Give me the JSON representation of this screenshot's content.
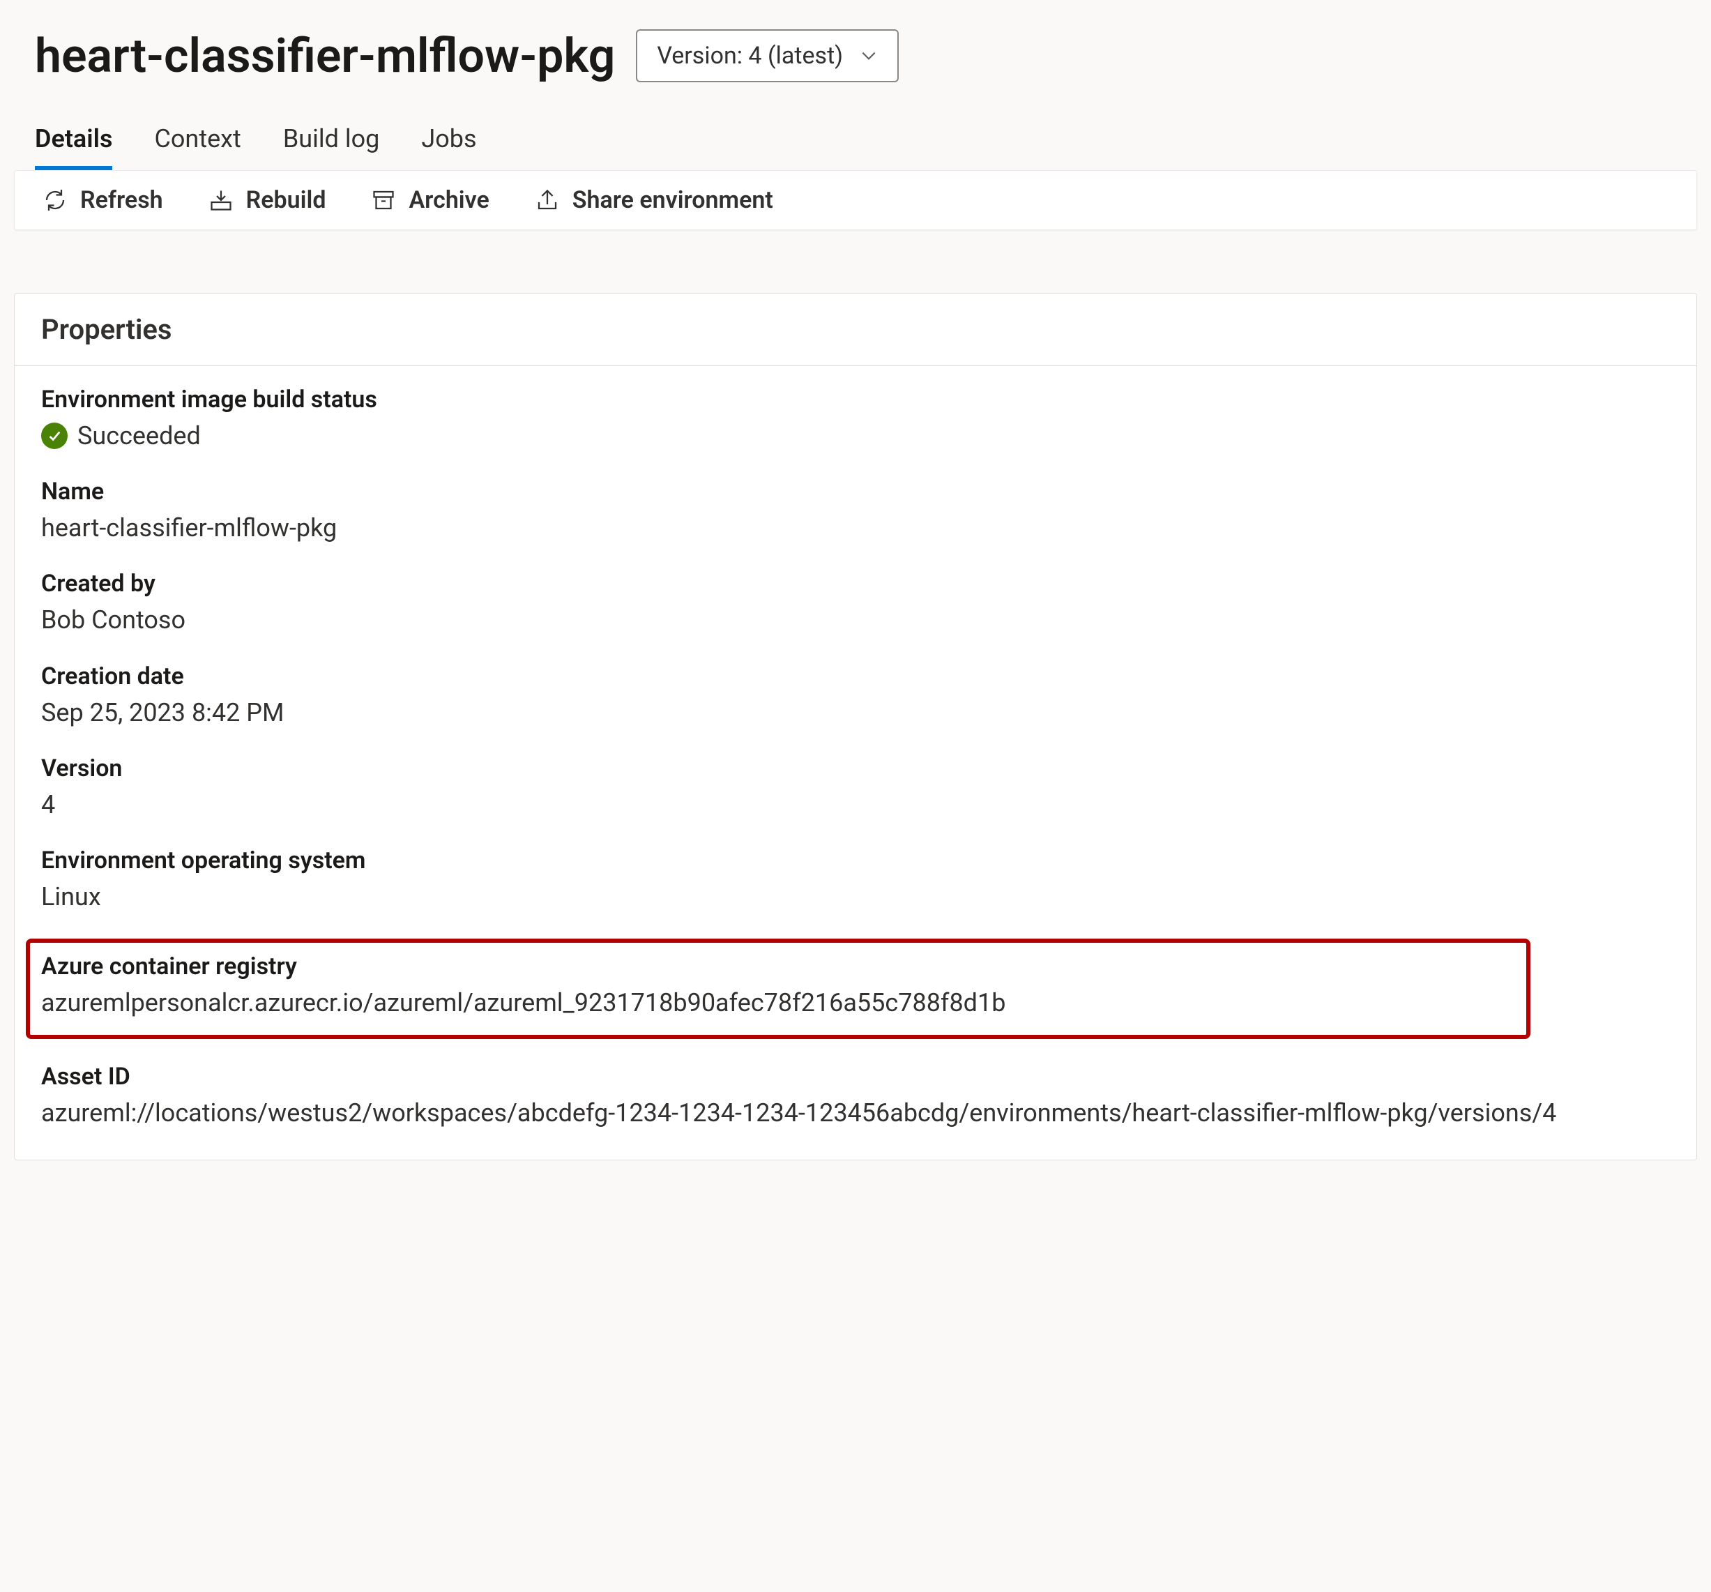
{
  "header": {
    "title": "heart-classifier-mlflow-pkg",
    "version_selector": "Version: 4 (latest)"
  },
  "tabs": {
    "details": "Details",
    "context": "Context",
    "build_log": "Build log",
    "jobs": "Jobs"
  },
  "toolbar": {
    "refresh": "Refresh",
    "rebuild": "Rebuild",
    "archive": "Archive",
    "share": "Share environment"
  },
  "card": {
    "title": "Properties"
  },
  "properties": {
    "build_status_label": "Environment image build status",
    "build_status_value": "Succeeded",
    "name_label": "Name",
    "name_value": "heart-classifier-mlflow-pkg",
    "created_by_label": "Created by",
    "created_by_value": "Bob Contoso",
    "creation_date_label": "Creation date",
    "creation_date_value": "Sep 25, 2023 8:42 PM",
    "version_label": "Version",
    "version_value": "4",
    "os_label": "Environment operating system",
    "os_value": "Linux",
    "acr_label": "Azure container registry",
    "acr_value": "azuremlpersonalcr.azurecr.io/azureml/azureml_9231718b90afec78f216a55c788f8d1b",
    "asset_id_label": "Asset ID",
    "asset_id_value": "azureml://locations/westus2/workspaces/abcdefg-1234-1234-1234-123456abcdg/environments/heart-classifier-mlflow-pkg/versions/4"
  }
}
